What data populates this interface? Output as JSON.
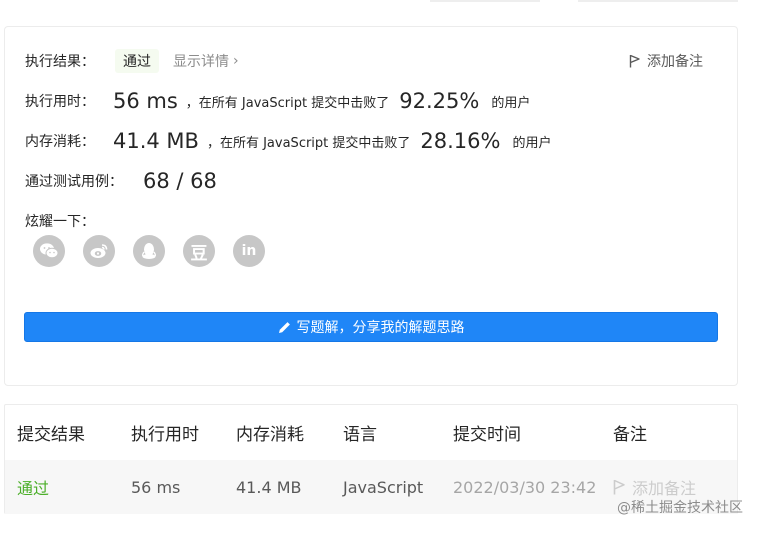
{
  "result": {
    "label": "执行结果：",
    "status": "通过",
    "details": "显示详情",
    "add_note": "添加备注"
  },
  "runtime": {
    "label": "执行用时：",
    "value": "56 ms",
    "mid": "，在所有 JavaScript 提交中击败了",
    "percent": "92.25%",
    "suffix": "的用户"
  },
  "memory": {
    "label": "内存消耗：",
    "value": "41.4 MB",
    "mid": "，在所有 JavaScript 提交中击败了",
    "percent": "28.16%",
    "suffix": "的用户"
  },
  "tests": {
    "label": "通过测试用例：",
    "value": "68 / 68"
  },
  "share": {
    "label": "炫耀一下：",
    "icons": [
      "wechat-icon",
      "weibo-icon",
      "qq-icon",
      "douban-icon",
      "linkedin-icon"
    ],
    "douban_glyph": "豆",
    "linkedin_glyph": "in"
  },
  "solution_button": "写题解，分享我的解题思路",
  "table": {
    "headers": [
      "提交结果",
      "执行用时",
      "内存消耗",
      "语言",
      "提交时间",
      "备注"
    ],
    "row": {
      "status": "通过",
      "runtime": "56 ms",
      "memory": "41.4 MB",
      "language": "JavaScript",
      "time": "2022/03/30 23:42",
      "note": "添加备注"
    }
  },
  "watermark": "@稀土掘金技术社区",
  "colors": {
    "accent": "#1f86f7",
    "success": "#4caf2a",
    "muted": "#8c8c8c",
    "share_icon_bg": "#c7c7c7"
  }
}
